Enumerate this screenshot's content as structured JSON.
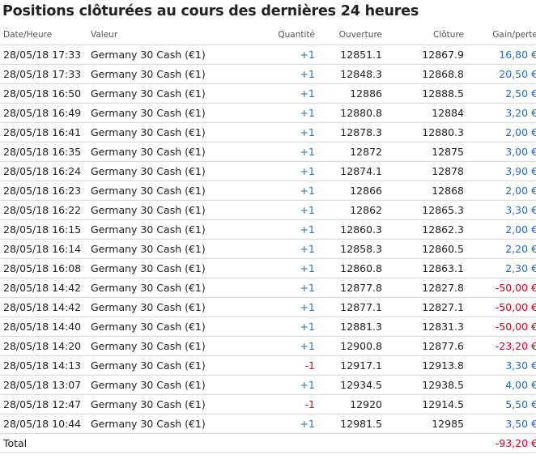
{
  "title": "Positions clôturées au cours des dernières 24 heures",
  "columns": {
    "date": "Date/Heure",
    "instrument": "Valeur",
    "quantity": "Quantité",
    "open": "Ouverture",
    "close": "Clôture",
    "pl": "Gain/perte"
  },
  "rows": [
    {
      "date": "28/05/18 17:33",
      "instrument": "Germany 30 Cash (€1)",
      "quantity": "+1",
      "open": "12851.1",
      "close": "12867.9",
      "pl": "16,80 €"
    },
    {
      "date": "28/05/18 17:33",
      "instrument": "Germany 30 Cash (€1)",
      "quantity": "+1",
      "open": "12848.3",
      "close": "12868.8",
      "pl": "20,50 €"
    },
    {
      "date": "28/05/18 16:50",
      "instrument": "Germany 30 Cash (€1)",
      "quantity": "+1",
      "open": "12886",
      "close": "12888.5",
      "pl": "2,50 €"
    },
    {
      "date": "28/05/18 16:49",
      "instrument": "Germany 30 Cash (€1)",
      "quantity": "+1",
      "open": "12880.8",
      "close": "12884",
      "pl": "3,20 €"
    },
    {
      "date": "28/05/18 16:41",
      "instrument": "Germany 30 Cash (€1)",
      "quantity": "+1",
      "open": "12878.3",
      "close": "12880.3",
      "pl": "2,00 €"
    },
    {
      "date": "28/05/18 16:35",
      "instrument": "Germany 30 Cash (€1)",
      "quantity": "+1",
      "open": "12872",
      "close": "12875",
      "pl": "3,00 €"
    },
    {
      "date": "28/05/18 16:24",
      "instrument": "Germany 30 Cash (€1)",
      "quantity": "+1",
      "open": "12874.1",
      "close": "12878",
      "pl": "3,90 €"
    },
    {
      "date": "28/05/18 16:23",
      "instrument": "Germany 30 Cash (€1)",
      "quantity": "+1",
      "open": "12866",
      "close": "12868",
      "pl": "2,00 €"
    },
    {
      "date": "28/05/18 16:22",
      "instrument": "Germany 30 Cash (€1)",
      "quantity": "+1",
      "open": "12862",
      "close": "12865.3",
      "pl": "3,30 €"
    },
    {
      "date": "28/05/18 16:15",
      "instrument": "Germany 30 Cash (€1)",
      "quantity": "+1",
      "open": "12860.3",
      "close": "12862.3",
      "pl": "2,00 €"
    },
    {
      "date": "28/05/18 16:14",
      "instrument": "Germany 30 Cash (€1)",
      "quantity": "+1",
      "open": "12858.3",
      "close": "12860.5",
      "pl": "2,20 €"
    },
    {
      "date": "28/05/18 16:08",
      "instrument": "Germany 30 Cash (€1)",
      "quantity": "+1",
      "open": "12860.8",
      "close": "12863.1",
      "pl": "2,30 €"
    },
    {
      "date": "28/05/18 14:42",
      "instrument": "Germany 30 Cash (€1)",
      "quantity": "+1",
      "open": "12877.8",
      "close": "12827.8",
      "pl": "-50,00 €"
    },
    {
      "date": "28/05/18 14:42",
      "instrument": "Germany 30 Cash (€1)",
      "quantity": "+1",
      "open": "12877.1",
      "close": "12827.1",
      "pl": "-50,00 €"
    },
    {
      "date": "28/05/18 14:40",
      "instrument": "Germany 30 Cash (€1)",
      "quantity": "+1",
      "open": "12881.3",
      "close": "12831.3",
      "pl": "-50,00 €"
    },
    {
      "date": "28/05/18 14:20",
      "instrument": "Germany 30 Cash (€1)",
      "quantity": "+1",
      "open": "12900.8",
      "close": "12877.6",
      "pl": "-23,20 €"
    },
    {
      "date": "28/05/18 14:13",
      "instrument": "Germany 30 Cash (€1)",
      "quantity": "-1",
      "open": "12917.1",
      "close": "12913.8",
      "pl": "3,30 €"
    },
    {
      "date": "28/05/18 13:07",
      "instrument": "Germany 30 Cash (€1)",
      "quantity": "+1",
      "open": "12934.5",
      "close": "12938.5",
      "pl": "4,00 €"
    },
    {
      "date": "28/05/18 12:47",
      "instrument": "Germany 30 Cash (€1)",
      "quantity": "-1",
      "open": "12920",
      "close": "12914.5",
      "pl": "5,50 €"
    },
    {
      "date": "28/05/18 10:44",
      "instrument": "Germany 30 Cash (€1)",
      "quantity": "+1",
      "open": "12981.5",
      "close": "12985",
      "pl": "3,50 €"
    }
  ],
  "total": {
    "label": "Total",
    "pl": "-93,20 €"
  },
  "colors": {
    "positive": "#2a6ebb",
    "negative": "#d0021b"
  }
}
